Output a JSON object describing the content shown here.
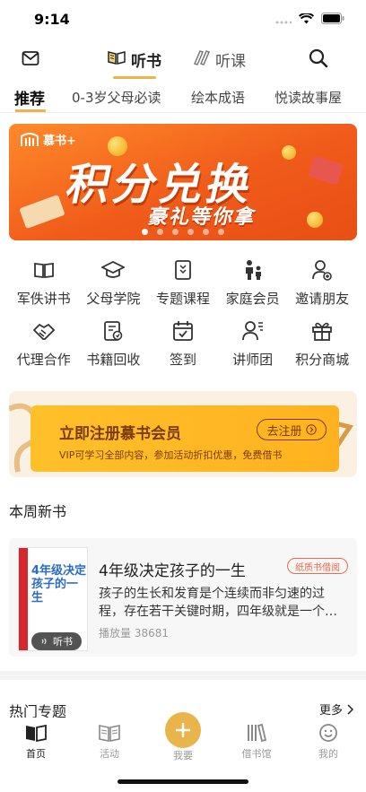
{
  "status": {
    "time": "9:14"
  },
  "top_nav": {
    "tabs": [
      {
        "label": "听书",
        "icon": "book-open-icon",
        "active": true
      },
      {
        "label": "听课",
        "icon": "pencil-icon",
        "active": false
      }
    ]
  },
  "categories": [
    "推荐",
    "0-3岁父母必读",
    "绘本成语",
    "悦读故事屋"
  ],
  "banner": {
    "logo": "慕书+",
    "title": "积分兑换",
    "subtitle": "豪礼等你拿",
    "dots": 6,
    "active_dot": 0
  },
  "grid": {
    "row1": [
      {
        "label": "军佚讲书",
        "icon": "book-icon"
      },
      {
        "label": "父母学院",
        "icon": "graduation-cap-icon"
      },
      {
        "label": "专题课程",
        "icon": "bookmark-icon"
      },
      {
        "label": "家庭会员",
        "icon": "family-icon"
      },
      {
        "label": "邀请朋友",
        "icon": "invite-user-icon"
      }
    ],
    "row2": [
      {
        "label": "代理合作",
        "icon": "handshake-icon"
      },
      {
        "label": "书籍回收",
        "icon": "recycle-book-icon"
      },
      {
        "label": "签到",
        "icon": "calendar-check-icon"
      },
      {
        "label": "讲师团",
        "icon": "lecturer-icon"
      },
      {
        "label": "积分商城",
        "icon": "gift-icon"
      }
    ]
  },
  "member": {
    "title": "立即注册慕书会员",
    "button": "去注册",
    "desc": "VIP可学习全部内容，参加活动折扣优惠，免费借书"
  },
  "new_books": {
    "section_title": "本周新书",
    "book": {
      "cover_title": "4年级决定孩子的一生",
      "cover_badge": "听书",
      "title": "4年级决定孩子的一生",
      "tag": "纸质书借阅",
      "desc": "孩子的生长和发育是个连续而非匀速的过程，存在若干关键时期，四年级就是一个…",
      "plays": "播放量 38681"
    }
  },
  "hot": {
    "section_title": "热门专题",
    "more": "更多"
  },
  "tabbar": {
    "items": [
      {
        "label": "首页",
        "icon": "home-book-icon",
        "active": true
      },
      {
        "label": "活动",
        "icon": "activity-book-icon",
        "active": false
      },
      {
        "label": "我要",
        "icon": "plus-icon",
        "active": false
      },
      {
        "label": "借书馆",
        "icon": "library-icon",
        "active": false
      },
      {
        "label": "我的",
        "icon": "smiley-icon",
        "active": false
      }
    ]
  },
  "colors": {
    "accent": "#e9b54a",
    "banner": "#f05b1a",
    "member_bg": "#ffb21f",
    "tag": "#f0674a"
  }
}
